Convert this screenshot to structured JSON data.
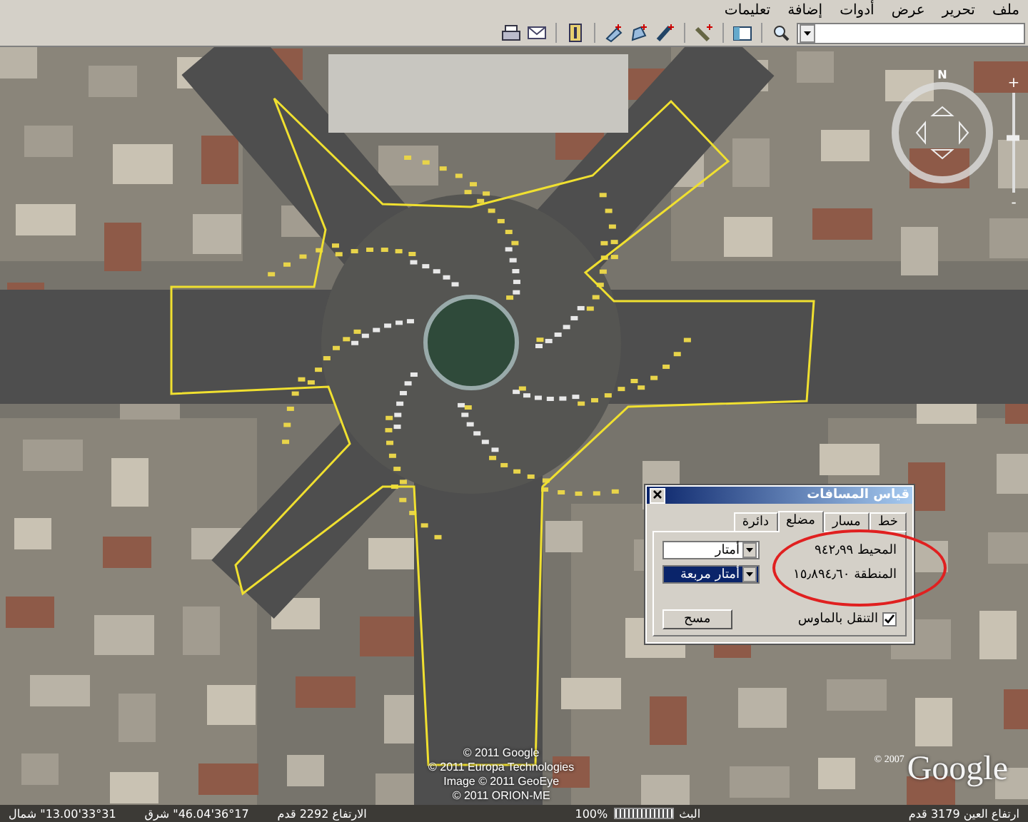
{
  "menu": [
    {
      "label": "ملف"
    },
    {
      "label": "تحرير"
    },
    {
      "label": "عرض"
    },
    {
      "label": "أدوات"
    },
    {
      "label": "إضافة"
    },
    {
      "label": "تعليمات"
    }
  ],
  "navigation": {
    "north": "N",
    "zoom_in": "+",
    "zoom_out": "-",
    "zoom_slider": {
      "level": 0.55
    }
  },
  "ruler_dialog": {
    "title": "قياس المسافات",
    "tabs": [
      {
        "label": "خط",
        "selected": false
      },
      {
        "label": "مسار",
        "selected": false
      },
      {
        "label": "مضلع",
        "selected": true
      },
      {
        "label": "دائرة",
        "selected": false
      }
    ],
    "measurements": [
      {
        "label": "المحيط",
        "value": "٩٤٢٫٩٩",
        "unit": "أمتار",
        "selected": false
      },
      {
        "label": "المنطقة",
        "value": "١٥٫٨٩٤٫٦٠",
        "unit": "أمتار مربعة",
        "selected": true
      }
    ],
    "mouse_navigation": {
      "label": "التنقل بالماوس",
      "checked": true
    },
    "clear_button": "مسح"
  },
  "attribution": [
    "© 2011 Google",
    "© 2011 Europa Technologies",
    "Image © 2011 GeoEye",
    "© 2011 ORION-ME"
  ],
  "logo": {
    "copyright": "© 2007",
    "name": "Google"
  },
  "status_bar": {
    "latitude": "33°31'13.00\" شمال",
    "longitude": "36°17'46.04\" شرق",
    "elevation": "الارتفاع 2292 قدم",
    "streaming_label": "البث",
    "streaming": {
      "level": 1,
      "reading": "100%"
    },
    "eye_altitude": "ارتفاع العين 3179 قدم"
  }
}
